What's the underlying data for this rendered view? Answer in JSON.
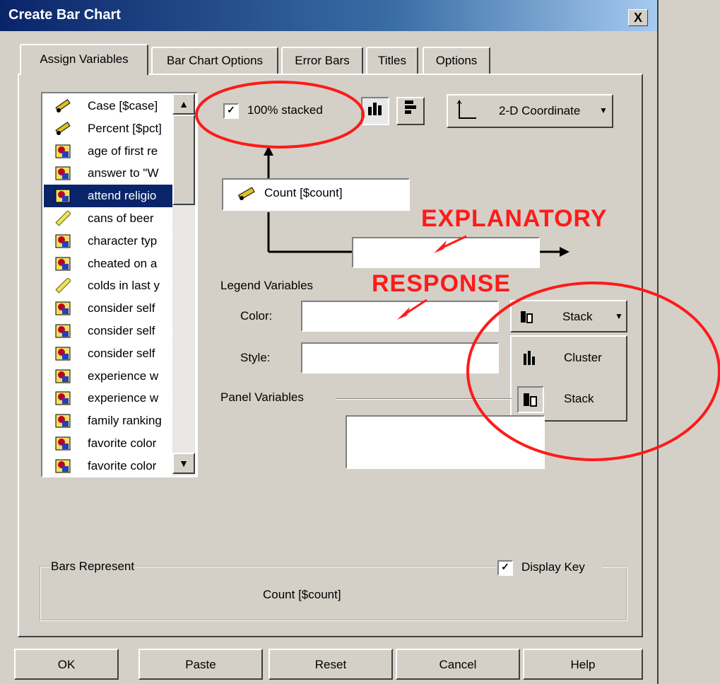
{
  "window": {
    "title": "Create Bar Chart",
    "close_label": "X"
  },
  "tabs": [
    {
      "label": "Assign Variables",
      "active": true
    },
    {
      "label": "Bar Chart Options"
    },
    {
      "label": "Error Bars"
    },
    {
      "label": "Titles"
    },
    {
      "label": "Options"
    }
  ],
  "variables": [
    {
      "label": "Case [$case]",
      "icon": "ruler-pencil-icon"
    },
    {
      "label": "Percent [$pct]",
      "icon": "ruler-pencil-icon"
    },
    {
      "label": "age of first re",
      "icon": "nominal-icon"
    },
    {
      "label": "answer to \"W",
      "icon": "nominal-icon"
    },
    {
      "label": "attend religio",
      "icon": "nominal-icon",
      "selected": true
    },
    {
      "label": "cans of beer",
      "icon": "ruler-icon"
    },
    {
      "label": "character typ",
      "icon": "nominal-icon"
    },
    {
      "label": "cheated on a",
      "icon": "nominal-icon"
    },
    {
      "label": "colds in last y",
      "icon": "ruler-icon"
    },
    {
      "label": "consider self",
      "icon": "nominal-icon"
    },
    {
      "label": "consider self",
      "icon": "nominal-icon"
    },
    {
      "label": "consider self",
      "icon": "nominal-icon"
    },
    {
      "label": "experience w",
      "icon": "nominal-icon"
    },
    {
      "label": "experience w",
      "icon": "nominal-icon"
    },
    {
      "label": "family ranking",
      "icon": "nominal-icon"
    },
    {
      "label": "favorite color",
      "icon": "nominal-icon"
    },
    {
      "label": "favorite color",
      "icon": "nominal-icon"
    }
  ],
  "options": {
    "stacked_label": "100% stacked",
    "stacked_checked": true,
    "coordinate_label": "2-D Coordinate"
  },
  "y_variable": "Count [$count]",
  "legend": {
    "heading": "Legend Variables",
    "color_label": "Color:",
    "style_label": "Style:",
    "mode_label": "Stack",
    "mode_options": [
      "Cluster",
      "Stack"
    ]
  },
  "panel": {
    "heading": "Panel Variables"
  },
  "annotations": {
    "explanatory": "EXPLANATORY",
    "response": "RESPONSE"
  },
  "bars_represent": {
    "heading": "Bars Represent",
    "value": "Count [$count]",
    "display_key_label": "Display Key",
    "display_key_checked": true
  },
  "buttons": {
    "ok": "OK",
    "paste": "Paste",
    "reset": "Reset",
    "cancel": "Cancel",
    "help": "Help"
  },
  "colors": {
    "selection": "#0a246a",
    "annotation": "#ff1a1a",
    "titlebar": "#0a246a"
  }
}
